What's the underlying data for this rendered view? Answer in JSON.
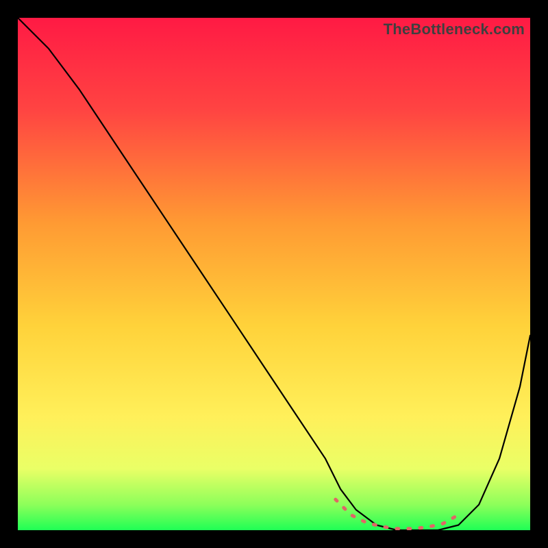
{
  "watermark": "TheBottleneck.com",
  "chart_data": {
    "type": "line",
    "title": "",
    "xlabel": "",
    "ylabel": "",
    "xlim": [
      0,
      100
    ],
    "ylim": [
      0,
      100
    ],
    "grid": false,
    "legend": false,
    "gradient_stops": [
      {
        "offset": 0,
        "color": "#ff1a44"
      },
      {
        "offset": 18,
        "color": "#ff4442"
      },
      {
        "offset": 40,
        "color": "#ff9a33"
      },
      {
        "offset": 60,
        "color": "#ffd23a"
      },
      {
        "offset": 78,
        "color": "#fff05a"
      },
      {
        "offset": 88,
        "color": "#eaff66"
      },
      {
        "offset": 95,
        "color": "#8dff5a"
      },
      {
        "offset": 100,
        "color": "#1fff55"
      }
    ],
    "series": [
      {
        "name": "bottleneck-curve",
        "color": "#000000",
        "x": [
          0,
          6,
          12,
          18,
          24,
          30,
          36,
          42,
          48,
          54,
          60,
          63,
          66,
          70,
          74,
          78,
          82,
          86,
          90,
          94,
          98,
          100
        ],
        "y": [
          100,
          94,
          86,
          77,
          68,
          59,
          50,
          41,
          32,
          23,
          14,
          8,
          4,
          1,
          0,
          0,
          0,
          1,
          5,
          14,
          28,
          38
        ]
      }
    ],
    "highlight": {
      "name": "optimal-range",
      "color": "#e06666",
      "x": [
        62,
        65,
        68,
        71,
        74,
        77,
        80,
        83,
        86
      ],
      "y": [
        6,
        3,
        1.5,
        0.7,
        0.3,
        0.3,
        0.6,
        1.3,
        3
      ]
    }
  }
}
